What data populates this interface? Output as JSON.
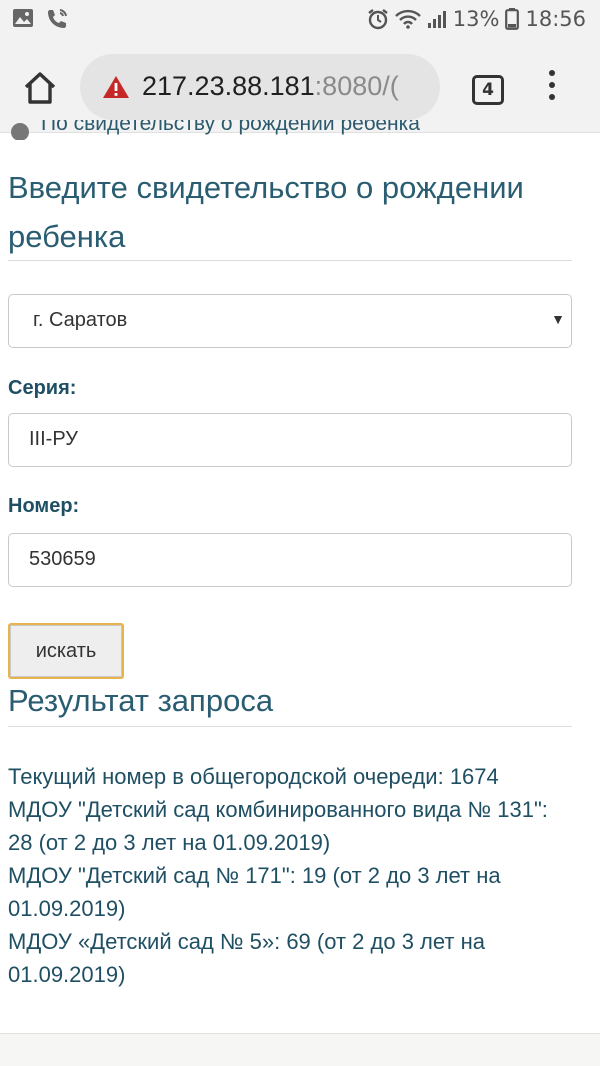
{
  "status_bar": {
    "battery": "13%",
    "time": "18:56"
  },
  "browser": {
    "url_host": "217.23.88.181",
    "url_rest": ":8080/(",
    "tab_count": "4"
  },
  "form": {
    "radio_partial_label": "По свидетельству о рождении ребенка",
    "title": "Введите свидетельство о рождении ребенка",
    "city_select": "г. Саратов",
    "series_label": "Серия:",
    "series_value": "III-РУ",
    "number_label": "Номер:",
    "number_value": "530659",
    "search_button": "искать"
  },
  "result": {
    "title": "Результат запроса",
    "lines": [
      "Текущий номер в общегородской очереди: 1674",
      "МДОУ \"Детский сад комбинированного вида № 131\": 28 (от 2 до 3 лет на 01.09.2019)",
      "МДОУ \"Детский сад № 171\": 19 (от 2 до 3 лет на 01.09.2019)",
      "МДОУ «Детский сад № 5»: 69 (от 2 до 3 лет на 01.09.2019)"
    ]
  }
}
